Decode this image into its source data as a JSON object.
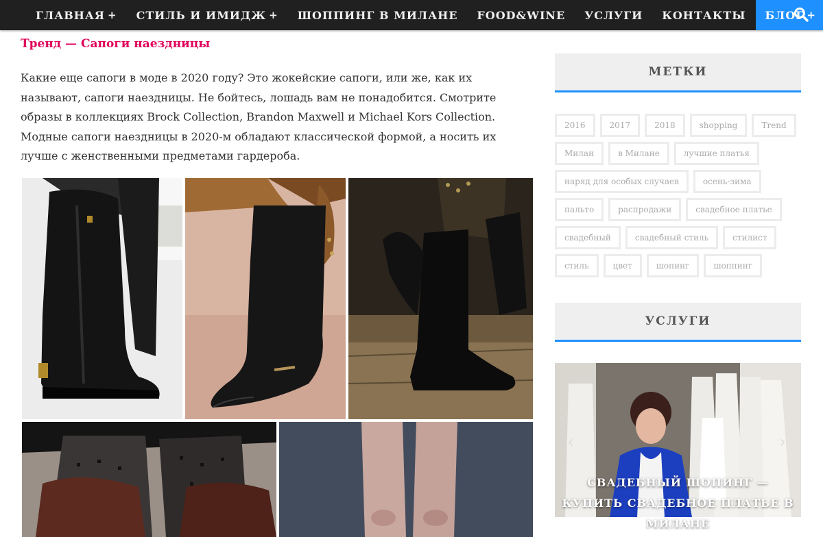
{
  "nav": {
    "items": [
      {
        "label": "ГЛАВНАЯ",
        "plus": "+"
      },
      {
        "label": "СТИЛЬ И ИМИДЖ",
        "plus": "+"
      },
      {
        "label": "ШОППИНГ В МИЛАНЕ",
        "plus": ""
      },
      {
        "label": "FOOD&WINE",
        "plus": ""
      },
      {
        "label": "УСЛУГИ",
        "plus": ""
      },
      {
        "label": "КОНТАКТЫ",
        "plus": ""
      },
      {
        "label": "БЛОГ",
        "plus": "+"
      }
    ],
    "active_item": "БЛОГ",
    "search_icon": "search-icon"
  },
  "post": {
    "subtitle": "Тренд — Сапоги наездницы",
    "paragraph": "Какие еще сапоги в моде в 2020 году? Это жокейские сапоги, или же, как их называют, сапоги наездницы. Не бойтесь, лошадь вам не понадобится. Смотрите образы в коллекциях Brock Collection, Brandon Maxwell и Michael Kors Collection. Модные сапоги наездницы в 2020-м обладают классической формой, а носить их лучше с женственными предметами гардероба."
  },
  "sidebar": {
    "tags_title": "МЕТКИ",
    "tags": [
      "2016",
      "2017",
      "2018",
      "shopping",
      "Trend",
      "Милан",
      "в Милане",
      "лучшие платья",
      "наряд для особых случаев",
      "осень-зима",
      "пальто",
      "распродажи",
      "свадебное платье",
      "свадебный",
      "свадебный стиль",
      "стилист",
      "стиль",
      "цвет",
      "шопинг",
      "шоппинг"
    ],
    "services_title": "УСЛУГИ",
    "slider": {
      "prev": "‹",
      "next": "›",
      "caption": "СВАДЕБНЫЙ ШОПИНГ — КУПИТЬ СВАДЕБНОЕ ПЛАТЬЕ В МИЛАНЕ"
    }
  },
  "colors": {
    "nav_bg": "#202020",
    "active": "#1e90ff",
    "accent_pink": "#e0005a"
  }
}
